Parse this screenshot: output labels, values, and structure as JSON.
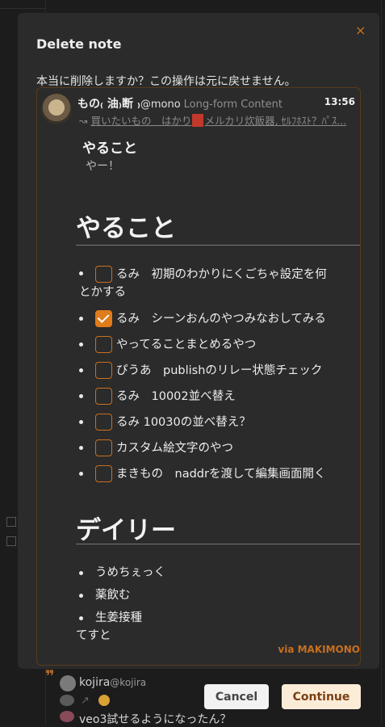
{
  "background": {
    "post": {
      "author_name": "kojira",
      "author_handle": "@kojira",
      "text": "veo3試せるようになったん？"
    }
  },
  "dialog": {
    "title": "Delete note",
    "close_glyph": "×",
    "message": "本当に削除しますか？この操作は元に戻せません。",
    "cancel_label": "Cancel",
    "continue_label": "Continue"
  },
  "note": {
    "author_name": "もの₍ 油₎断 ₎",
    "author_handle": "@mono",
    "kind": "Long-form Content",
    "time": "13:56",
    "reply_line_a": "買いたいもの　はかり",
    "reply_line_b": "メルカリ炊飯器, ｾﾙﾌﾎｽﾄ？ﾊﾟｽ...",
    "summary_title": "やること",
    "summary_sub": "やー！",
    "heading_tasks": "やること",
    "tasks": [
      {
        "line1": "るみ　初期のわかりにくごちゃ設定を何",
        "line2": "とかする",
        "checked": false
      },
      {
        "label": "るみ　シーンおんのやつみなおしてみる",
        "checked": true
      },
      {
        "label": "やってることまとめるやつ",
        "checked": false
      },
      {
        "label": "ぴうあ　publishのリレー状態チェック",
        "checked": false
      },
      {
        "label": "るみ　10002並べ替え",
        "checked": false
      },
      {
        "label": "るみ 10030の並べ替え？",
        "checked": false
      },
      {
        "label": "カスタム絵文字のやつ",
        "checked": false
      },
      {
        "label": "まきもの　naddrを渡して編集画面開く",
        "checked": false
      }
    ],
    "heading_daily": "デイリー",
    "daily": [
      "うめちぇっく",
      "薬飲む",
      "生姜接種"
    ],
    "tail": "てすと",
    "via": "via MAKIMONO"
  },
  "colors": {
    "accent": "#c7701f",
    "checkbox_checked": "#e07c1a",
    "modal_bg": "#2b2b2b",
    "page_bg": "#1c1c1c"
  }
}
